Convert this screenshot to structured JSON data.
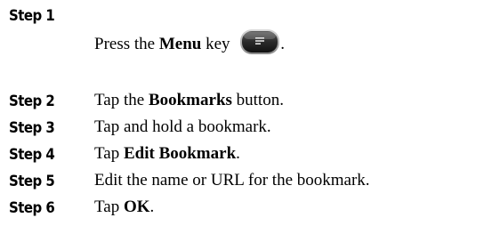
{
  "steps": [
    {
      "label": "Step 1",
      "parts": [
        "Press the ",
        "Menu",
        " key",
        "."
      ],
      "icon": "menu-key-icon"
    },
    {
      "label": "Step 2",
      "parts": [
        "Tap the ",
        "Bookmarks",
        " button."
      ]
    },
    {
      "label": "Step 3",
      "parts": [
        "Tap and hold a bookmark."
      ]
    },
    {
      "label": "Step 4",
      "parts": [
        "Tap ",
        "Edit Bookmark",
        "."
      ]
    },
    {
      "label": "Step 5",
      "parts": [
        "Edit the name or URL for the bookmark."
      ]
    },
    {
      "label": "Step 6",
      "parts": [
        "Tap ",
        "OK",
        "."
      ]
    }
  ]
}
